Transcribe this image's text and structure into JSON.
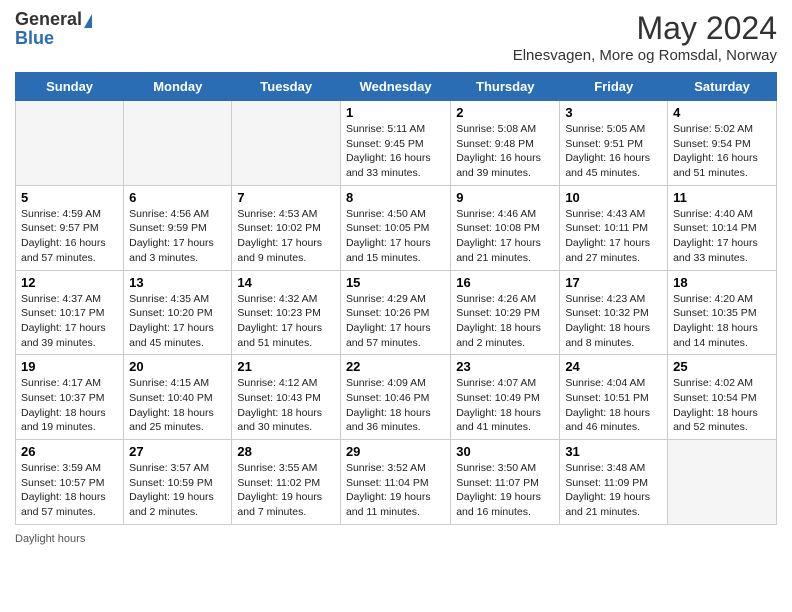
{
  "logo": {
    "general": "General",
    "blue": "Blue"
  },
  "title": "May 2024",
  "subtitle": "Elnesvagen, More og Romsdal, Norway",
  "days_of_week": [
    "Sunday",
    "Monday",
    "Tuesday",
    "Wednesday",
    "Thursday",
    "Friday",
    "Saturday"
  ],
  "footer_text": "Daylight hours",
  "weeks": [
    [
      {
        "num": "",
        "sunrise": "",
        "sunset": "",
        "daylight": ""
      },
      {
        "num": "",
        "sunrise": "",
        "sunset": "",
        "daylight": ""
      },
      {
        "num": "",
        "sunrise": "",
        "sunset": "",
        "daylight": ""
      },
      {
        "num": "1",
        "sunrise": "Sunrise: 5:11 AM",
        "sunset": "Sunset: 9:45 PM",
        "daylight": "Daylight: 16 hours and 33 minutes."
      },
      {
        "num": "2",
        "sunrise": "Sunrise: 5:08 AM",
        "sunset": "Sunset: 9:48 PM",
        "daylight": "Daylight: 16 hours and 39 minutes."
      },
      {
        "num": "3",
        "sunrise": "Sunrise: 5:05 AM",
        "sunset": "Sunset: 9:51 PM",
        "daylight": "Daylight: 16 hours and 45 minutes."
      },
      {
        "num": "4",
        "sunrise": "Sunrise: 5:02 AM",
        "sunset": "Sunset: 9:54 PM",
        "daylight": "Daylight: 16 hours and 51 minutes."
      }
    ],
    [
      {
        "num": "5",
        "sunrise": "Sunrise: 4:59 AM",
        "sunset": "Sunset: 9:57 PM",
        "daylight": "Daylight: 16 hours and 57 minutes."
      },
      {
        "num": "6",
        "sunrise": "Sunrise: 4:56 AM",
        "sunset": "Sunset: 9:59 PM",
        "daylight": "Daylight: 17 hours and 3 minutes."
      },
      {
        "num": "7",
        "sunrise": "Sunrise: 4:53 AM",
        "sunset": "Sunset: 10:02 PM",
        "daylight": "Daylight: 17 hours and 9 minutes."
      },
      {
        "num": "8",
        "sunrise": "Sunrise: 4:50 AM",
        "sunset": "Sunset: 10:05 PM",
        "daylight": "Daylight: 17 hours and 15 minutes."
      },
      {
        "num": "9",
        "sunrise": "Sunrise: 4:46 AM",
        "sunset": "Sunset: 10:08 PM",
        "daylight": "Daylight: 17 hours and 21 minutes."
      },
      {
        "num": "10",
        "sunrise": "Sunrise: 4:43 AM",
        "sunset": "Sunset: 10:11 PM",
        "daylight": "Daylight: 17 hours and 27 minutes."
      },
      {
        "num": "11",
        "sunrise": "Sunrise: 4:40 AM",
        "sunset": "Sunset: 10:14 PM",
        "daylight": "Daylight: 17 hours and 33 minutes."
      }
    ],
    [
      {
        "num": "12",
        "sunrise": "Sunrise: 4:37 AM",
        "sunset": "Sunset: 10:17 PM",
        "daylight": "Daylight: 17 hours and 39 minutes."
      },
      {
        "num": "13",
        "sunrise": "Sunrise: 4:35 AM",
        "sunset": "Sunset: 10:20 PM",
        "daylight": "Daylight: 17 hours and 45 minutes."
      },
      {
        "num": "14",
        "sunrise": "Sunrise: 4:32 AM",
        "sunset": "Sunset: 10:23 PM",
        "daylight": "Daylight: 17 hours and 51 minutes."
      },
      {
        "num": "15",
        "sunrise": "Sunrise: 4:29 AM",
        "sunset": "Sunset: 10:26 PM",
        "daylight": "Daylight: 17 hours and 57 minutes."
      },
      {
        "num": "16",
        "sunrise": "Sunrise: 4:26 AM",
        "sunset": "Sunset: 10:29 PM",
        "daylight": "Daylight: 18 hours and 2 minutes."
      },
      {
        "num": "17",
        "sunrise": "Sunrise: 4:23 AM",
        "sunset": "Sunset: 10:32 PM",
        "daylight": "Daylight: 18 hours and 8 minutes."
      },
      {
        "num": "18",
        "sunrise": "Sunrise: 4:20 AM",
        "sunset": "Sunset: 10:35 PM",
        "daylight": "Daylight: 18 hours and 14 minutes."
      }
    ],
    [
      {
        "num": "19",
        "sunrise": "Sunrise: 4:17 AM",
        "sunset": "Sunset: 10:37 PM",
        "daylight": "Daylight: 18 hours and 19 minutes."
      },
      {
        "num": "20",
        "sunrise": "Sunrise: 4:15 AM",
        "sunset": "Sunset: 10:40 PM",
        "daylight": "Daylight: 18 hours and 25 minutes."
      },
      {
        "num": "21",
        "sunrise": "Sunrise: 4:12 AM",
        "sunset": "Sunset: 10:43 PM",
        "daylight": "Daylight: 18 hours and 30 minutes."
      },
      {
        "num": "22",
        "sunrise": "Sunrise: 4:09 AM",
        "sunset": "Sunset: 10:46 PM",
        "daylight": "Daylight: 18 hours and 36 minutes."
      },
      {
        "num": "23",
        "sunrise": "Sunrise: 4:07 AM",
        "sunset": "Sunset: 10:49 PM",
        "daylight": "Daylight: 18 hours and 41 minutes."
      },
      {
        "num": "24",
        "sunrise": "Sunrise: 4:04 AM",
        "sunset": "Sunset: 10:51 PM",
        "daylight": "Daylight: 18 hours and 46 minutes."
      },
      {
        "num": "25",
        "sunrise": "Sunrise: 4:02 AM",
        "sunset": "Sunset: 10:54 PM",
        "daylight": "Daylight: 18 hours and 52 minutes."
      }
    ],
    [
      {
        "num": "26",
        "sunrise": "Sunrise: 3:59 AM",
        "sunset": "Sunset: 10:57 PM",
        "daylight": "Daylight: 18 hours and 57 minutes."
      },
      {
        "num": "27",
        "sunrise": "Sunrise: 3:57 AM",
        "sunset": "Sunset: 10:59 PM",
        "daylight": "Daylight: 19 hours and 2 minutes."
      },
      {
        "num": "28",
        "sunrise": "Sunrise: 3:55 AM",
        "sunset": "Sunset: 11:02 PM",
        "daylight": "Daylight: 19 hours and 7 minutes."
      },
      {
        "num": "29",
        "sunrise": "Sunrise: 3:52 AM",
        "sunset": "Sunset: 11:04 PM",
        "daylight": "Daylight: 19 hours and 11 minutes."
      },
      {
        "num": "30",
        "sunrise": "Sunrise: 3:50 AM",
        "sunset": "Sunset: 11:07 PM",
        "daylight": "Daylight: 19 hours and 16 minutes."
      },
      {
        "num": "31",
        "sunrise": "Sunrise: 3:48 AM",
        "sunset": "Sunset: 11:09 PM",
        "daylight": "Daylight: 19 hours and 21 minutes."
      },
      {
        "num": "",
        "sunrise": "",
        "sunset": "",
        "daylight": ""
      }
    ]
  ]
}
